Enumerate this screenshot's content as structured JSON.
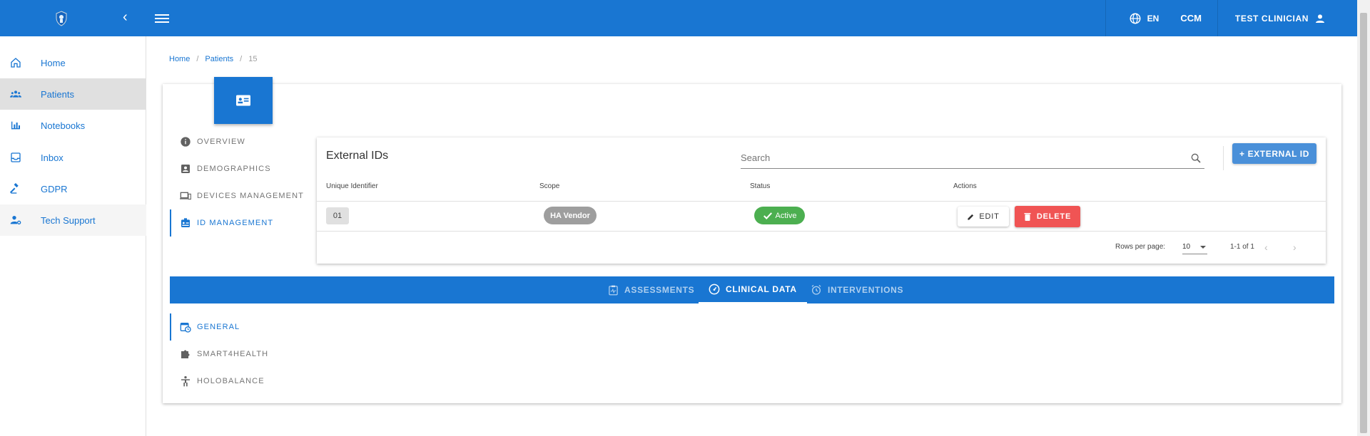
{
  "topbar": {
    "language": "EN",
    "ccm": "CCM",
    "user_name": "TEST CLINICIAN"
  },
  "sidebar": {
    "items": [
      {
        "label": "Home",
        "icon": "home-icon"
      },
      {
        "label": "Patients",
        "icon": "people-icon"
      },
      {
        "label": "Notebooks",
        "icon": "bar-chart-icon"
      },
      {
        "label": "Inbox",
        "icon": "inbox-icon"
      },
      {
        "label": "GDPR",
        "icon": "gavel-icon"
      },
      {
        "label": "Tech Support",
        "icon": "support-user-icon"
      }
    ]
  },
  "breadcrumb": {
    "home": "Home",
    "patients": "Patients",
    "current": "15"
  },
  "patient_nav": {
    "items": [
      {
        "label": "OVERVIEW",
        "icon": "info-icon"
      },
      {
        "label": "DEMOGRAPHICS",
        "icon": "contact-card-icon"
      },
      {
        "label": "DEVICES MANAGEMENT",
        "icon": "devices-icon"
      },
      {
        "label": "ID MANAGEMENT",
        "icon": "id-badge-icon"
      }
    ]
  },
  "external_ids": {
    "title": "External IDs",
    "search_placeholder": "Search",
    "add_button": "+ EXTERNAL ID",
    "columns": [
      "Unique Identifier",
      "Scope",
      "Status",
      "Actions"
    ],
    "rows": [
      {
        "uid": "01",
        "scope": "HA Vendor",
        "status": "Active",
        "edit": "EDIT",
        "delete": "DELETE"
      }
    ],
    "rows_per_page_label": "Rows per page:",
    "rows_per_page": "10",
    "range": "1-1 of 1"
  },
  "tabs": {
    "items": [
      {
        "label": "ASSESSMENTS",
        "icon": "assessment-icon"
      },
      {
        "label": "CLINICAL DATA",
        "icon": "gauge-icon"
      },
      {
        "label": "INTERVENTIONS",
        "icon": "alarm-icon"
      }
    ]
  },
  "clinical_nav": {
    "items": [
      {
        "label": "GENERAL",
        "icon": "calendar-clock-icon"
      },
      {
        "label": "SMART4HEALTH",
        "icon": "puzzle-icon"
      },
      {
        "label": "HOLOBALANCE",
        "icon": "accessibility-icon"
      }
    ]
  },
  "colors": {
    "primary": "#1976d2",
    "active_green": "#4caf50",
    "delete_red": "#f05454",
    "scope_gray": "#9e9e9e"
  }
}
